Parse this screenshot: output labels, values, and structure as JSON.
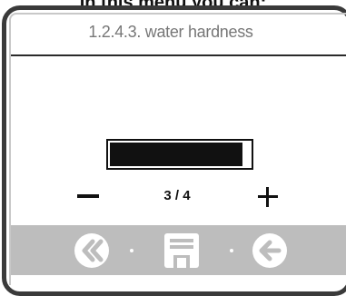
{
  "caption": "In this menu you can:",
  "screen": {
    "title": "1.2.4.3. water hardness",
    "level": {
      "current": 3,
      "max": 4,
      "fill_fraction": 0.95
    },
    "step_text": "3 / 4"
  },
  "icons": {
    "minus": "minus-icon",
    "plus": "plus-icon",
    "back": "double-chevron-left-icon",
    "save": "floppy-disk-icon",
    "enter": "arrow-left-circle-icon"
  },
  "colors": {
    "frame": "#3a3a3a",
    "footer": "#bdbdbd",
    "title_text": "#777777",
    "bar_fill": "#111111"
  }
}
